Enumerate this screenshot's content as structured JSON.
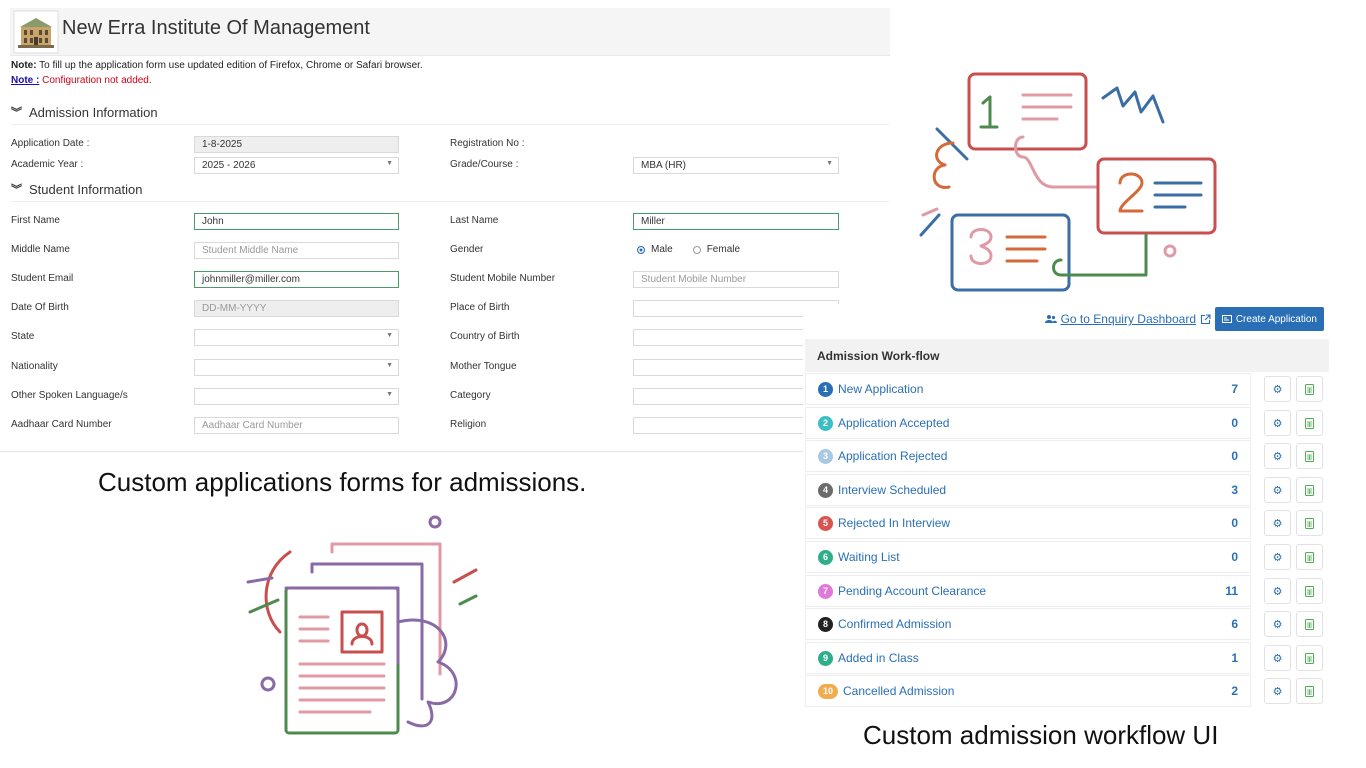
{
  "form": {
    "institute_name": "New Erra Institute Of Management",
    "note_label": "Note:",
    "note_text": "To fill up the application form use updated edition of Firefox, Chrome or Safari browser.",
    "note2_label": "Note :",
    "note2_text": "Configuration not added.",
    "admission_section": "Admission Information",
    "student_section": "Student Information",
    "fields": {
      "application_date": {
        "label": "Application Date :",
        "value": "1-8-2025"
      },
      "registration_no": {
        "label": "Registration No :"
      },
      "academic_year": {
        "label": "Academic Year :",
        "value": "2025 - 2026"
      },
      "grade_course": {
        "label": "Grade/Course :",
        "value": "MBA (HR)"
      },
      "first_name": {
        "label": "First Name",
        "value": "John"
      },
      "last_name": {
        "label": "Last Name",
        "value": "Miller"
      },
      "middle_name": {
        "label": "Middle Name",
        "placeholder": "Student Middle Name"
      },
      "gender": {
        "label": "Gender",
        "options": [
          "Male",
          "Female"
        ],
        "selected": "Male"
      },
      "student_email": {
        "label": "Student Email",
        "value": "johnmiller@miller.com"
      },
      "student_mobile": {
        "label": "Student Mobile Number",
        "placeholder": "Student Mobile Number"
      },
      "date_of_birth": {
        "label": "Date Of Birth",
        "placeholder": "DD-MM-YYYY"
      },
      "place_of_birth": {
        "label": "Place of Birth"
      },
      "state": {
        "label": "State"
      },
      "country_of_birth": {
        "label": "Country of Birth"
      },
      "nationality": {
        "label": "Nationality"
      },
      "mother_tongue": {
        "label": "Mother Tongue"
      },
      "other_language": {
        "label": "Other Spoken Language/s"
      },
      "category": {
        "label": "Category"
      },
      "aadhaar": {
        "label": "Aadhaar Card Number",
        "placeholder": "Aadhaar Card Number"
      },
      "religion": {
        "label": "Religion"
      }
    }
  },
  "captions": {
    "forms": "Custom applications forms for admissions.",
    "workflow": "Custom admission workflow UI"
  },
  "workflow": {
    "enquiry_link": "Go to Enquiry Dashboard",
    "create_button": "Create Application",
    "title": "Admission Work-flow",
    "stages": [
      {
        "num": "1",
        "label": "New Application",
        "count": "7",
        "color": "#2a6fb5"
      },
      {
        "num": "2",
        "label": "Application Accepted",
        "count": "0",
        "color": "#3bbfc4"
      },
      {
        "num": "3",
        "label": "Application Rejected",
        "count": "0",
        "color": "#a9c8e6"
      },
      {
        "num": "4",
        "label": "Interview Scheduled",
        "count": "3",
        "color": "#6b6b6b"
      },
      {
        "num": "5",
        "label": "Rejected In Interview",
        "count": "0",
        "color": "#d9534f"
      },
      {
        "num": "6",
        "label": "Waiting List",
        "count": "0",
        "color": "#2eae8a"
      },
      {
        "num": "7",
        "label": "Pending Account Clearance",
        "count": "11",
        "color": "#e07ad8"
      },
      {
        "num": "8",
        "label": "Confirmed Admission",
        "count": "6",
        "color": "#222222"
      },
      {
        "num": "9",
        "label": "Added in Class",
        "count": "1",
        "color": "#2eae8a"
      },
      {
        "num": "10",
        "label": "Cancelled Admission",
        "count": "2",
        "color": "#f0ad4e"
      }
    ]
  },
  "icons": [
    "building-logo-icon",
    "chevron-double-down-icon",
    "dropdown-caret-icon",
    "users-icon",
    "external-link-icon",
    "card-icon",
    "gear-icon",
    "spreadsheet-icon",
    "workflow-illustration-icon",
    "document-illustration-icon"
  ]
}
